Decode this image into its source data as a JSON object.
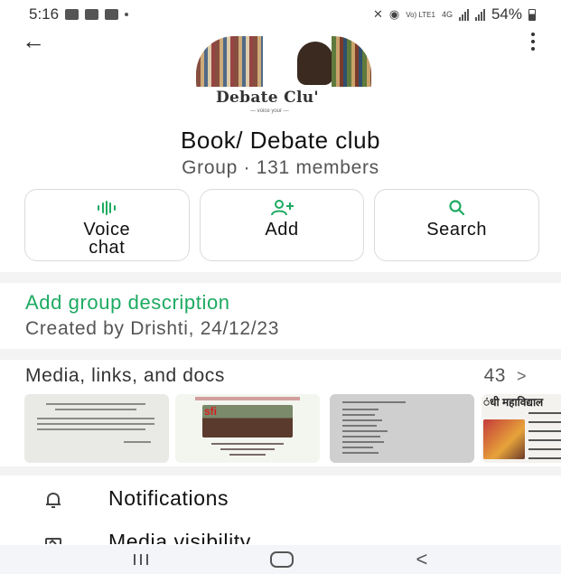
{
  "status_bar": {
    "time": "5:16",
    "battery": "54%",
    "network_labels": [
      "Vo) LTE1",
      "4G"
    ]
  },
  "header": {
    "avatar_title": "Debate Clu'",
    "avatar_subtitle": "— voice your —"
  },
  "group": {
    "name": "Book/ Debate club",
    "meta": "Group · 131 members"
  },
  "actions": [
    {
      "label": "Voice chat",
      "icon": "voice-wave-icon"
    },
    {
      "label": "Add",
      "icon": "add-person-icon"
    },
    {
      "label": "Search",
      "icon": "search-icon"
    }
  ],
  "description": {
    "link": "Add group description",
    "created": "Created by Drishti, 24/12/23"
  },
  "media": {
    "heading": "Media, links, and docs",
    "count": "43",
    "chevron": ">",
    "thumb4_text": "ंधी महाविद्याल",
    "thumb2_badge": "sfi"
  },
  "settings": [
    {
      "label": "Notifications",
      "icon": "bell-icon"
    },
    {
      "label": "Media visibility",
      "icon": "image-icon"
    }
  ],
  "colors": {
    "accent": "#1daa61",
    "divider": "#f2f3f2"
  }
}
